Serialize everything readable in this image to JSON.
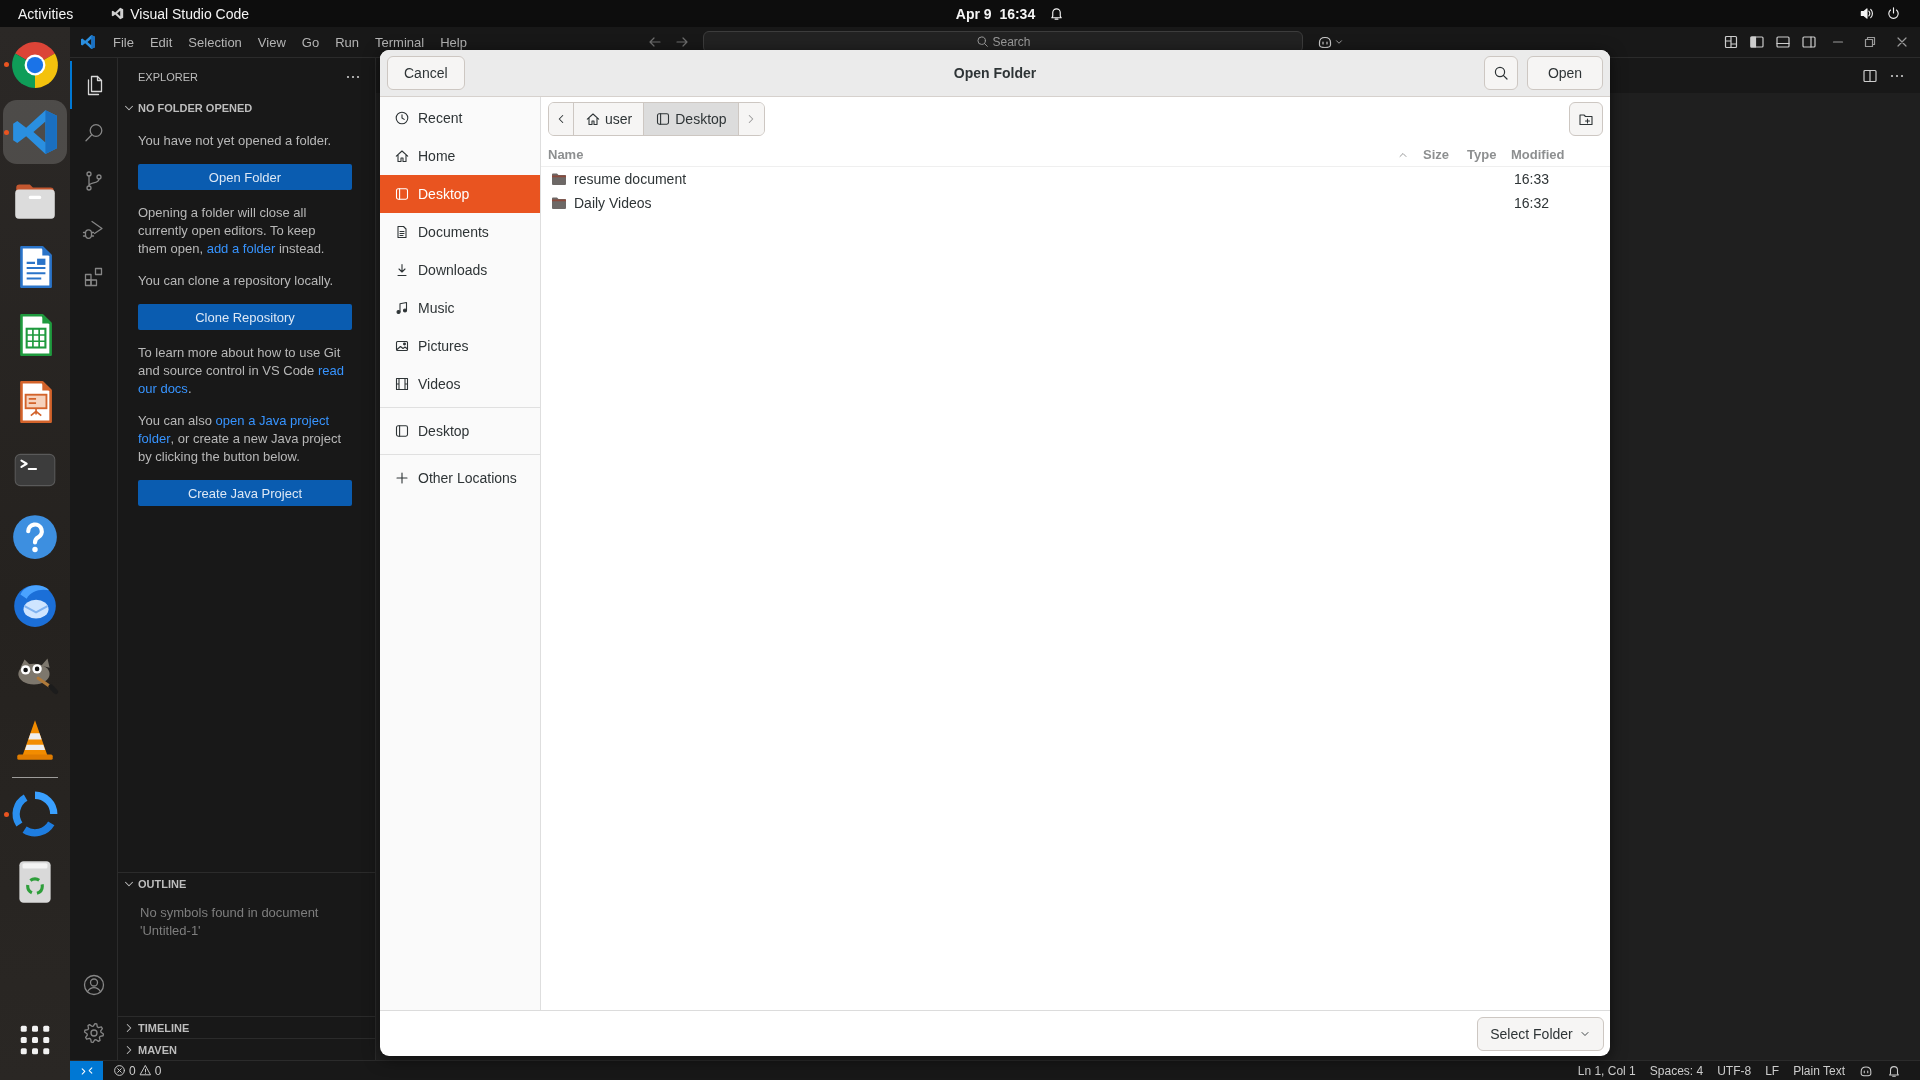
{
  "top_bar": {
    "activities": "Activities",
    "app_name": "Visual Studio Code",
    "clock": "Apr 9  16:34"
  },
  "dock": {
    "favorites": [
      {
        "kind": "browser",
        "running": true,
        "focused": false
      },
      {
        "kind": "code",
        "running": true,
        "focused": true
      },
      {
        "kind": "files",
        "running": false,
        "focused": false
      },
      {
        "kind": "writer",
        "running": false,
        "focused": false
      },
      {
        "kind": "calc",
        "running": false,
        "focused": false
      },
      {
        "kind": "impress",
        "running": false,
        "focused": false
      },
      {
        "kind": "terminal",
        "running": false,
        "focused": false
      },
      {
        "kind": "help",
        "running": false,
        "focused": false
      },
      {
        "kind": "mail",
        "running": false,
        "focused": false
      },
      {
        "kind": "paint",
        "running": false,
        "focused": false
      },
      {
        "kind": "player",
        "running": false,
        "focused": false
      }
    ],
    "others": [
      {
        "kind": "sync",
        "running": true,
        "focused": false
      },
      {
        "kind": "trash",
        "running": false,
        "focused": false
      }
    ]
  },
  "vscode": {
    "menu": [
      "File",
      "Edit",
      "Selection",
      "View",
      "Go",
      "Run",
      "Terminal",
      "Help"
    ],
    "search": {
      "placeholder": "Search"
    },
    "activity_bar": [
      {
        "kind": "explorer",
        "selected": true
      },
      {
        "kind": "search",
        "selected": false
      },
      {
        "kind": "source_control",
        "selected": false
      },
      {
        "kind": "run_debug",
        "selected": false
      },
      {
        "kind": "extensions",
        "selected": false
      }
    ],
    "sidebar": {
      "title": "EXPLORER",
      "sections": [
        {
          "title": "NO FOLDER OPENED",
          "expanded": true,
          "blocks": [
            {
              "kind": "text",
              "parts": [
                {
                  "kind": "text",
                  "text": "You have not yet opened a folder."
                }
              ]
            },
            {
              "kind": "button",
              "label": "Open Folder"
            },
            {
              "kind": "text",
              "parts": [
                {
                  "kind": "text",
                  "text": "Opening a folder will close all currently open editors. To keep them open, "
                },
                {
                  "kind": "link",
                  "text": "add a folder"
                },
                {
                  "kind": "text",
                  "text": " instead."
                }
              ]
            },
            {
              "kind": "text",
              "parts": [
                {
                  "kind": "text",
                  "text": "You can clone a repository locally."
                }
              ]
            },
            {
              "kind": "button",
              "label": "Clone Repository"
            },
            {
              "kind": "text",
              "parts": [
                {
                  "kind": "text",
                  "text": "To learn more about how to use Git and source control in VS Code "
                },
                {
                  "kind": "link",
                  "text": "read "
                },
                {
                  "kind": "link",
                  "text": "our docs"
                },
                {
                  "kind": "text",
                  "text": "."
                }
              ]
            },
            {
              "kind": "text",
              "parts": [
                {
                  "kind": "text",
                  "text": "You can also "
                },
                {
                  "kind": "link",
                  "text": "open a Java project "
                },
                {
                  "kind": "link",
                  "text": "folder"
                },
                {
                  "kind": "text",
                  "text": ", or create a new Java project by clicking the button below."
                }
              ]
            },
            {
              "kind": "button",
              "label": "Create Java Project"
            }
          ]
        },
        {
          "title": "OUTLINE",
          "expanded": true,
          "message": "No symbols found in document 'Untitled-1'"
        },
        {
          "title": "TIMELINE",
          "expanded": false
        },
        {
          "title": "MAVEN",
          "expanded": false
        }
      ]
    },
    "status_bar": {
      "errors": "0",
      "warnings": "0",
      "items": [
        "Ln 1, Col 1",
        "Spaces: 4",
        "UTF-8",
        "LF",
        "Plain Text"
      ]
    }
  },
  "dialog": {
    "title": "Open Folder",
    "cancel": "Cancel",
    "open": "Open",
    "sidebar": [
      {
        "items": [
          {
            "kind": "recent",
            "label": "Recent",
            "selected": false
          },
          {
            "kind": "home",
            "label": "Home",
            "selected": false
          },
          {
            "kind": "desktop",
            "label": "Desktop",
            "selected": true
          },
          {
            "kind": "documents",
            "label": "Documents",
            "selected": false
          },
          {
            "kind": "downloads",
            "label": "Downloads",
            "selected": false
          },
          {
            "kind": "music",
            "label": "Music",
            "selected": false
          },
          {
            "kind": "pictures",
            "label": "Pictures",
            "selected": false
          },
          {
            "kind": "videos",
            "label": "Videos",
            "selected": false
          }
        ]
      },
      {
        "items": [
          {
            "kind": "desktop",
            "label": "Desktop",
            "selected": false
          }
        ]
      },
      {
        "items": [
          {
            "kind": "other",
            "label": "Other Locations",
            "selected": false
          }
        ]
      }
    ],
    "path": [
      {
        "kind": "home",
        "label": "user",
        "selected": false
      },
      {
        "kind": "desktop",
        "label": "Desktop",
        "selected": true
      }
    ],
    "columns": [
      {
        "label": "Name",
        "sorted": true
      },
      {
        "label": "Size",
        "sorted": false
      },
      {
        "label": "Type",
        "sorted": false
      },
      {
        "label": "Modified",
        "sorted": false
      }
    ],
    "rows": [
      {
        "name": "resume document",
        "modified": "16:33"
      },
      {
        "name": "Daily Videos",
        "modified": "16:32"
      }
    ],
    "filter": "Select Folder"
  }
}
